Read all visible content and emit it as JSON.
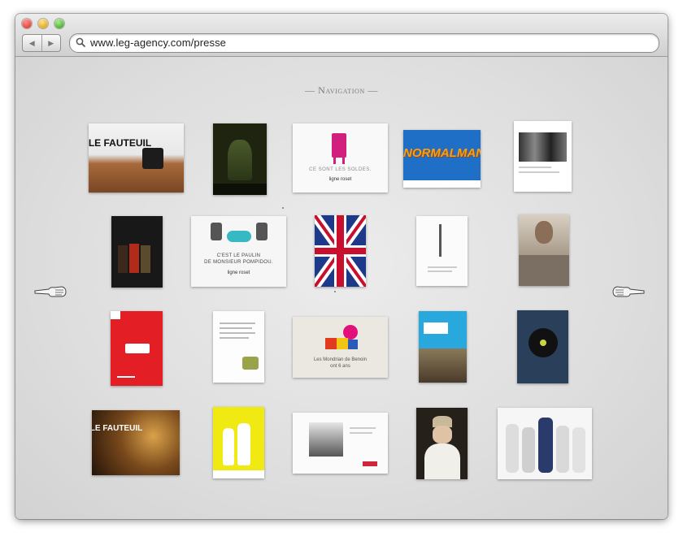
{
  "browser": {
    "url": "www.leg-agency.com/presse"
  },
  "page": {
    "nav_title": "Navigation"
  },
  "thumbnails": {
    "fauteuil_1": {
      "headline": "LE FAUTEUIL"
    },
    "normalman": {
      "headline": "NORMALMAN"
    },
    "soldes": {
      "caption": "CE SONT LES SOLDES.",
      "brand": "ligne roset"
    },
    "paulin": {
      "caption_1": "C'EST LE PAULIN",
      "caption_2": "DE MONSIEUR POMPIDOU.",
      "brand": "ligne roset"
    },
    "mondrian": {
      "caption_1": "Les Mondrian de Benoin",
      "caption_2": "ont 6 ans"
    },
    "fauteuil_2": {
      "headline": "LE FAUTEUIL"
    }
  },
  "colors": {
    "normalman_bg": "#1f6fc6",
    "normalman_text": "#f2a21a",
    "red_ad": "#e31e24",
    "yellow_ad": "#f1ea12",
    "chair_pink": "#d11f7d"
  }
}
